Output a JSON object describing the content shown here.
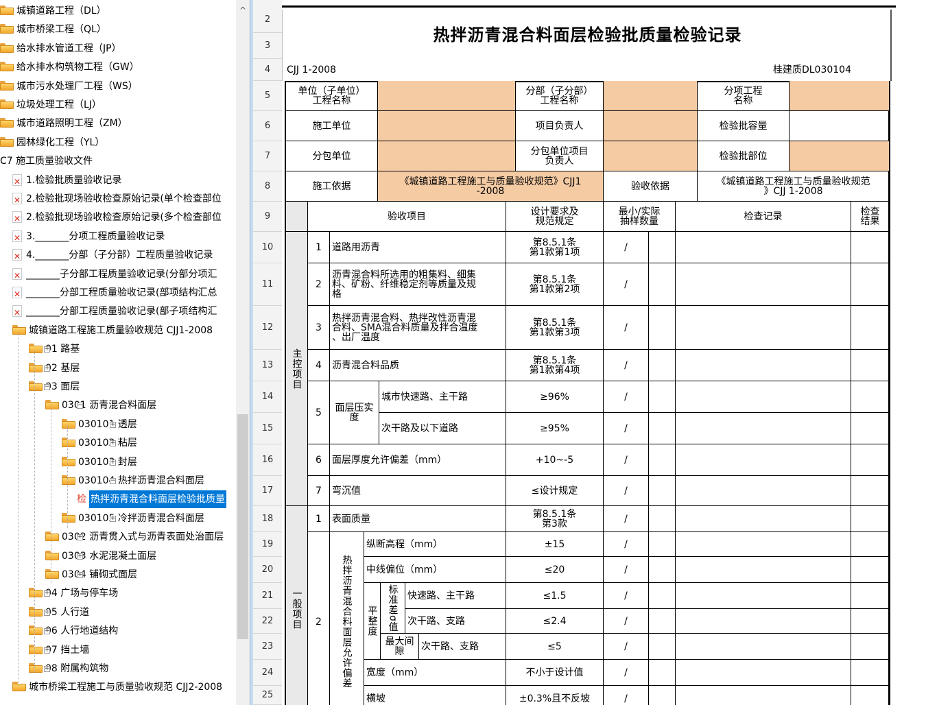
{
  "tree": [
    {
      "label": "城镇道路工程（DL）",
      "icon": "folder"
    },
    {
      "label": "城市桥梁工程（QL）",
      "icon": "folder"
    },
    {
      "label": "给水排水管道工程（JP）",
      "icon": "folder"
    },
    {
      "label": "给水排水构筑物工程（GW）",
      "icon": "folder"
    },
    {
      "label": "城市污水处理厂工程（WS）",
      "icon": "folder"
    },
    {
      "label": "垃圾处理工程（LJ）",
      "icon": "folder"
    },
    {
      "label": "城市道路照明工程（ZM）",
      "icon": "folder"
    },
    {
      "label": "园林绿化工程（YL）",
      "icon": "folder"
    },
    {
      "label": "C7 施工质量验收文件",
      "icon": "none"
    },
    {
      "label": "1.检验批质量验收记录",
      "icon": "pdf"
    },
    {
      "label": "2.检验批现场验收检查原始记录(单个检查部位",
      "icon": "pdf"
    },
    {
      "label": "2.检验批现场验收检查原始记录(多个检查部位",
      "icon": "pdf"
    },
    {
      "label": "3._______分项工程质量验收记录",
      "icon": "pdf"
    },
    {
      "label": "4._______分部（子分部）工程质量验收记录",
      "icon": "pdf"
    },
    {
      "label": "_______子分部工程质量验收记录(分部分项汇",
      "icon": "pdf"
    },
    {
      "label": "_______分部工程质量验收记录(部项结构汇总",
      "icon": "pdf"
    },
    {
      "label": "_______分部工程质量验收记录(部子项结构汇",
      "icon": "pdf"
    },
    {
      "label": "城镇道路工程施工质量验收规范 CJJ1-2008",
      "icon": "folder"
    },
    {
      "label": "01 路基",
      "icon": "folder"
    },
    {
      "label": "02 基层",
      "icon": "folder"
    },
    {
      "label": "03 面层",
      "icon": "folder"
    },
    {
      "label": "0301 沥青混合料面层",
      "icon": "folder"
    },
    {
      "label": "030101 透层",
      "icon": "folder"
    },
    {
      "label": "030102 粘层",
      "icon": "folder"
    },
    {
      "label": "030103 封层",
      "icon": "folder"
    },
    {
      "label": "030104 热拌沥青混合料面层",
      "icon": "folder"
    },
    {
      "label": "热拌沥青混合料面层检验批质量",
      "icon": "check",
      "prefix": "检"
    },
    {
      "label": "030105 冷拌沥青混合料面层",
      "icon": "folder"
    },
    {
      "label": "0302 沥青贯入式与沥青表面处治面层",
      "icon": "folder"
    },
    {
      "label": "0303 水泥混凝土面层",
      "icon": "folder"
    },
    {
      "label": "0304 铺砌式面层",
      "icon": "folder"
    },
    {
      "label": "04 广场与停车场",
      "icon": "folder"
    },
    {
      "label": "05 人行道",
      "icon": "folder"
    },
    {
      "label": "06 人行地道结构",
      "icon": "folder"
    },
    {
      "label": "07 挡土墙",
      "icon": "folder"
    },
    {
      "label": "08 附属构筑物",
      "icon": "folder"
    },
    {
      "label": "城市桥梁工程施工与质量验收规范 CJJ2-2008",
      "icon": "folder"
    }
  ],
  "rows": [
    "2",
    "3",
    "4",
    "5",
    "6",
    "7",
    "8",
    "9",
    "10",
    "11",
    "12",
    "13",
    "14",
    "15",
    "16",
    "17",
    "18",
    "19",
    "20",
    "21",
    "22",
    "23",
    "24",
    "25"
  ],
  "form": {
    "title": "热拌沥青混合料面层检验批质量检验记录",
    "std": "CJJ 1-2008",
    "code": "桂建质DL030104",
    "unit_name": "单位（子单位）\n工程名称",
    "part_name": "分部（子分部）\n工程名称",
    "item_name": "分项工程\n名称",
    "constructor": "施工单位",
    "manager": "项目负责人",
    "capacity": "检验批容量",
    "subcontractor": "分包单位",
    "sub_manager": "分包单位项目\n负责人",
    "batch_part": "检验批部位",
    "basis_label": "施工依据",
    "basis_value": "《城镇道路工程施工与质量验收规范》CJJ1\n-2008",
    "accept_label": "验收依据",
    "accept_value": "《城镇道路工程施工与质量验收规范\n》CJJ 1-2008",
    "h_item": "验收项目",
    "h_design": "设计要求及\n规范规定",
    "h_sample": "最小/实际\n抽样数量",
    "h_record": "检查记录",
    "h_result": "检查\n结果",
    "main_label": "主控项目",
    "general_label": "一般项目",
    "slash": "/",
    "main_items": [
      {
        "no": "1",
        "name": "道路用沥青",
        "spec": "第8.5.1条\n第1款第1项"
      },
      {
        "no": "2",
        "name": "沥青混合料所选用的粗集料、细集\n料、矿粉、纤维稳定剂等质量及规\n格",
        "spec": "第8.5.1条\n第1款第2项"
      },
      {
        "no": "3",
        "name": "热拌沥青混合料、热拌改性沥青混\n合料、SMA混合料质量及拌合温度\n、出厂温度",
        "spec": "第8.5.1条\n第1款第3项"
      },
      {
        "no": "4",
        "name": "沥青混合料品质",
        "spec": "第8.5.1条\n第1款第4项"
      },
      {
        "no": "5",
        "name": "面层压实\n度",
        "sub": [
          {
            "name": "城市快速路、主干路",
            "spec": "≥96%"
          },
          {
            "name": "次干路及以下道路",
            "spec": "≥95%"
          }
        ]
      },
      {
        "no": "6",
        "name": "面层厚度允许偏差（mm）",
        "spec": "+10~-5"
      },
      {
        "no": "7",
        "name": "弯沉值",
        "spec": "≤设计规定"
      }
    ],
    "gen1": {
      "no": "1",
      "name": "表面质量",
      "spec": "第8.5.1条\n第3款"
    },
    "gen2": {
      "no": "2",
      "group": "热拌沥青混合料面层允许偏差",
      "flat": "平整度",
      "std_dev": "标准差σ值",
      "max_gap": "最大间隙",
      "items": [
        {
          "name": "纵断高程（mm）",
          "spec": "±15"
        },
        {
          "name": "中线偏位（mm）",
          "spec": "≤20"
        },
        {
          "name": "快速路、主干路",
          "spec": "≤1.5"
        },
        {
          "name": "次干路、支路",
          "spec": "≤2.4"
        },
        {
          "name": "次干路、支路",
          "spec": "≤5"
        },
        {
          "name": "宽度（mm）",
          "spec": "不小于设计值"
        },
        {
          "name": "横坡",
          "spec": "±0.3%且不反坡"
        }
      ]
    }
  }
}
